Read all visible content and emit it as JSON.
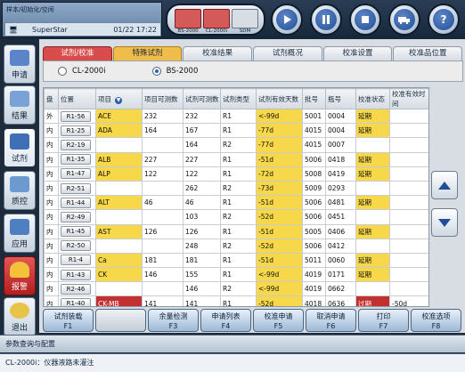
{
  "header": {
    "breadcrumb": "样本/初始化/空闲",
    "username": "SuperStar",
    "datetime": "01/22 17:22",
    "instruments": [
      "BS-2000",
      "CL-2000i",
      "SDM"
    ]
  },
  "sidebar": {
    "items": [
      {
        "label": "申请",
        "icon": "application-icon"
      },
      {
        "label": "结果",
        "icon": "results-icon"
      },
      {
        "label": "试剂",
        "icon": "reagent-icon",
        "active": true
      },
      {
        "label": "质控",
        "icon": "qc-icon"
      },
      {
        "label": "应用",
        "icon": "app-icon"
      },
      {
        "label": "报警",
        "icon": "bell-icon",
        "alarm": true
      },
      {
        "label": "退出",
        "icon": "exit-icon"
      }
    ]
  },
  "tabs": [
    {
      "label": "试剂/校准",
      "state": "active"
    },
    {
      "label": "特殊试剂",
      "state": "sub"
    },
    {
      "label": "校准结果"
    },
    {
      "label": "试剂概况"
    },
    {
      "label": "校准设置"
    },
    {
      "label": "校准品位置"
    }
  ],
  "analyzers": [
    {
      "label": "CL-2000i",
      "selected": false
    },
    {
      "label": "BS-2000",
      "selected": true
    }
  ],
  "table": {
    "columns": [
      "盘",
      "位置",
      "项目",
      "项目可测数",
      "试剂可测数",
      "试剂类型",
      "试剂有效天数",
      "批号",
      "瓶号",
      "校准状态",
      "校准有效时间"
    ],
    "rows": [
      [
        "外",
        "R1-56",
        "ACE",
        "232",
        "232",
        "R1",
        "<-99d",
        "5001",
        "0004",
        "延期",
        ""
      ],
      [
        "内",
        "R1-25",
        "ADA",
        "164",
        "167",
        "R1",
        "-77d",
        "4015",
        "0004",
        "延期",
        ""
      ],
      [
        "内",
        "R2-19",
        "",
        "",
        "164",
        "R2",
        "-77d",
        "4015",
        "0007",
        "",
        ""
      ],
      [
        "内",
        "R1-35",
        "ALB",
        "227",
        "227",
        "R1",
        "-51d",
        "5006",
        "0418",
        "延期",
        ""
      ],
      [
        "内",
        "R1-47",
        "ALP",
        "122",
        "122",
        "R1",
        "-72d",
        "5008",
        "0419",
        "延期",
        ""
      ],
      [
        "内",
        "R2-51",
        "",
        "",
        "262",
        "R2",
        "-73d",
        "5009",
        "0293",
        "",
        ""
      ],
      [
        "内",
        "R1-44",
        "ALT",
        "46",
        "46",
        "R1",
        "-51d",
        "5006",
        "0481",
        "延期",
        ""
      ],
      [
        "内",
        "R2-49",
        "",
        "",
        "103",
        "R2",
        "-52d",
        "5006",
        "0451",
        "",
        ""
      ],
      [
        "内",
        "R1-45",
        "AST",
        "126",
        "126",
        "R1",
        "-51d",
        "5005",
        "0406",
        "延期",
        ""
      ],
      [
        "内",
        "R2-50",
        "",
        "",
        "248",
        "R2",
        "-52d",
        "5006",
        "0412",
        "",
        ""
      ],
      [
        "内",
        "R1-4",
        "Ca",
        "181",
        "181",
        "R1",
        "-51d",
        "5011",
        "0060",
        "延期",
        ""
      ],
      [
        "内",
        "R1-43",
        "CK",
        "146",
        "155",
        "R1",
        "<-99d",
        "4019",
        "0171",
        "延期",
        ""
      ],
      [
        "内",
        "R2-46",
        "",
        "",
        "146",
        "R2",
        "<-99d",
        "4019",
        "0662",
        "",
        ""
      ],
      [
        "内",
        "R1-40",
        "CK-MB",
        "141",
        "141",
        "R1",
        "-52d",
        "4018",
        "0636",
        "过期",
        "-50d"
      ]
    ]
  },
  "functions": [
    {
      "label": "试剂装载",
      "key": "F1"
    },
    {
      "label": "",
      "key": ""
    },
    {
      "label": "余量检测",
      "key": "F3"
    },
    {
      "label": "申请列表",
      "key": "F4"
    },
    {
      "label": "校准申请",
      "key": "F5"
    },
    {
      "label": "取消申请",
      "key": "F6"
    },
    {
      "label": "打印",
      "key": "F7"
    },
    {
      "label": "校准选项",
      "key": "F8"
    }
  ],
  "footer": {
    "line1": "参数查询与配置",
    "line2": "CL-2000i：仪器液路未灌注"
  },
  "colors": {
    "highlight_yellow": "#f6d84a",
    "alert_red": "#c33030",
    "tab_active": "#d84c4c",
    "tab_special": "#f0bc4a"
  }
}
